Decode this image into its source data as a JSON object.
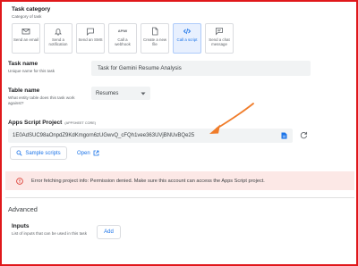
{
  "task_category": {
    "title": "Task category",
    "subtitle": "Category of task",
    "options": [
      {
        "label": "Send an email",
        "icon": "email-icon"
      },
      {
        "label": "Send a notification",
        "icon": "bell-icon"
      },
      {
        "label": "Send an SMS",
        "icon": "sms-icon"
      },
      {
        "label": "Call a webhook",
        "icon": "api-icon",
        "icon_text": "APIW"
      },
      {
        "label": "Create a new file",
        "icon": "file-icon"
      },
      {
        "label": "Call a script",
        "icon": "script-icon",
        "selected": true
      },
      {
        "label": "Send a chat message",
        "icon": "chat-icon"
      }
    ]
  },
  "task_name": {
    "title": "Task name",
    "subtitle": "Unique name for this task",
    "value": "Task for Gemini Resume Analysis"
  },
  "table_name": {
    "title": "Table name",
    "subtitle": "What entity table does this task work against?",
    "value": "Resumes"
  },
  "apps_script": {
    "title": "Apps Script Project",
    "tag": "(APPSHEET CORE)",
    "value": "1E0AdSUC98aOnpdZ9KdKmgorn6zUGwvQ_cFQh1vee363UVjBNUvBQe25",
    "sample_label": "Sample scripts",
    "open_label": "Open"
  },
  "error": {
    "message": "Error fetching project info: Permission denied. Make sure this account can access the Apps Script project."
  },
  "advanced": {
    "title": "Advanced"
  },
  "inputs": {
    "title": "Inputs",
    "subtitle": "List of inputs that can be used in this task",
    "add_label": "Add"
  },
  "colors": {
    "accent": "#1a73e8",
    "error": "#d93025",
    "annotation_arrow": "#f07c2a",
    "frame": "#e0181b"
  }
}
